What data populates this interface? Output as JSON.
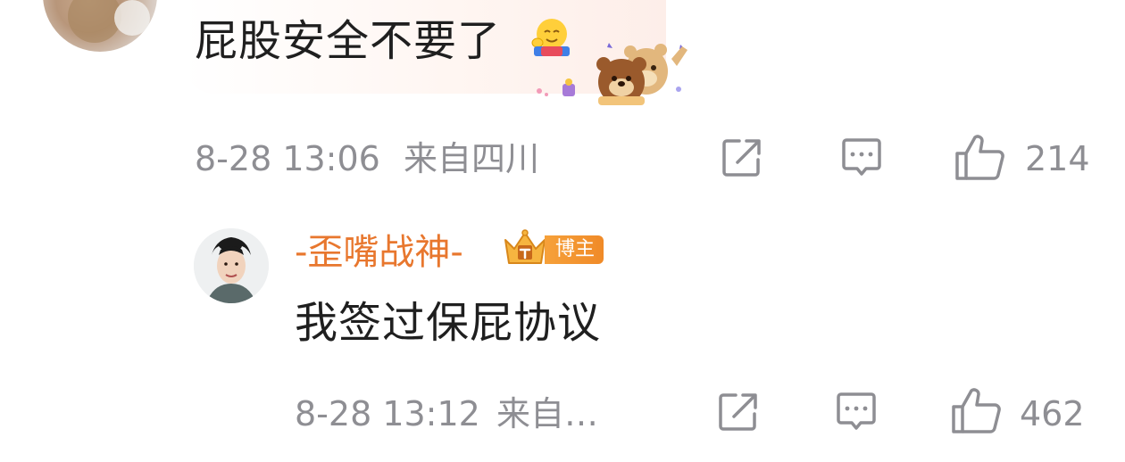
{
  "top_comment": {
    "text": "屁股安全不要了",
    "timestamp": "8-28 13:06",
    "location": "来自四川",
    "like_count": "214"
  },
  "reply": {
    "author": "-歪嘴战神-",
    "badge": "博主",
    "text": "我签过保屁协议",
    "timestamp": "8-28 13:12",
    "location": "来自…",
    "like_count": "462"
  },
  "icons": {
    "share": "share-icon",
    "comment": "comment-icon",
    "like": "thumbs-up-icon"
  },
  "colors": {
    "author_name": "#e8772e",
    "meta_text": "#8e8e93",
    "badge_bg": "#f39532"
  }
}
